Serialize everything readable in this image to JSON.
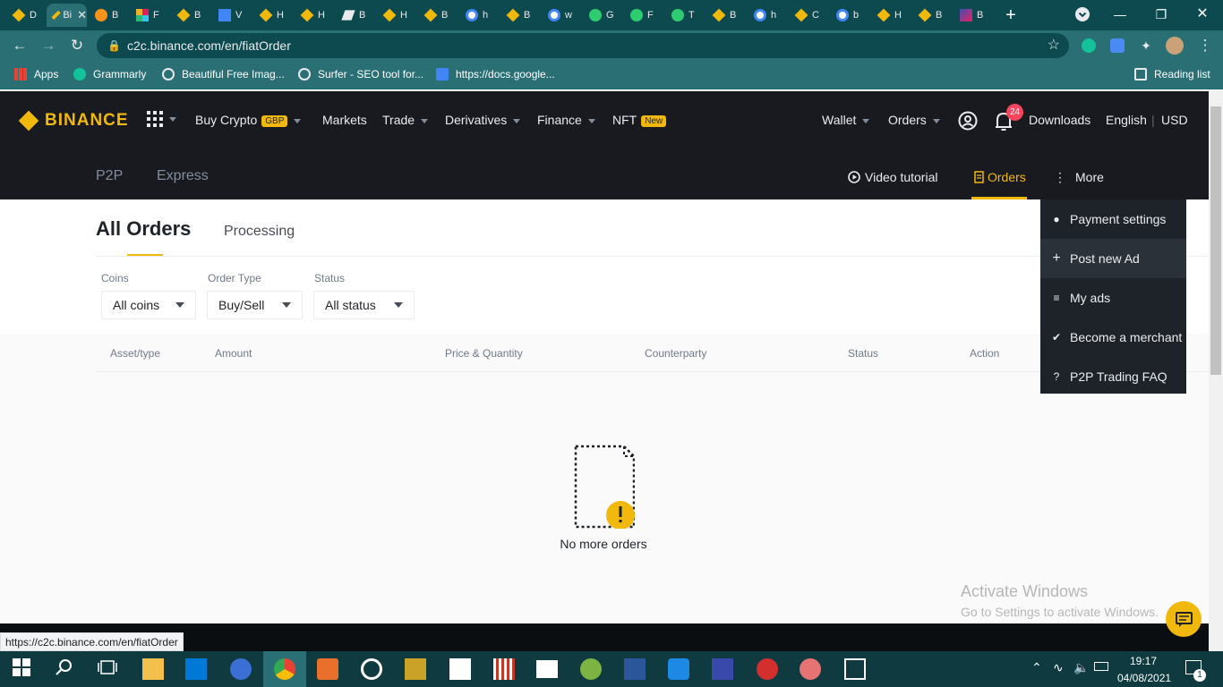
{
  "browser": {
    "tabs": [
      {
        "label": "D",
        "icon": "binance-icon"
      },
      {
        "label": "Bi",
        "icon": "binance-icon",
        "active": true
      },
      {
        "label": "B",
        "icon": "bitcoin-icon"
      },
      {
        "label": "F",
        "icon": "slack-icon"
      },
      {
        "label": "B",
        "icon": "binance-icon"
      },
      {
        "label": "V",
        "icon": "docs-icon"
      },
      {
        "label": "H",
        "icon": "binance-icon"
      },
      {
        "label": "H",
        "icon": "binance-icon"
      },
      {
        "label": "B",
        "icon": "bitmex-icon"
      },
      {
        "label": "H",
        "icon": "binance-icon"
      },
      {
        "label": "B",
        "icon": "binance-icon"
      },
      {
        "label": "h",
        "icon": "google-icon"
      },
      {
        "label": "B",
        "icon": "binance-icon"
      },
      {
        "label": "w",
        "icon": "google-icon"
      },
      {
        "label": "G",
        "icon": "surfer-icon"
      },
      {
        "label": "F",
        "icon": "surfer-icon"
      },
      {
        "label": "T",
        "icon": "surfer-icon"
      },
      {
        "label": "B",
        "icon": "binance-icon"
      },
      {
        "label": "h",
        "icon": "google-icon"
      },
      {
        "label": "C",
        "icon": "binance-icon"
      },
      {
        "label": "b",
        "icon": "google-icon"
      },
      {
        "label": "H",
        "icon": "binance-icon"
      },
      {
        "label": "B",
        "icon": "binance-icon"
      },
      {
        "label": "B",
        "icon": "image-icon"
      }
    ],
    "url": "c2c.binance.com/en/fiatOrder",
    "status_url": "https://c2c.binance.com/en/fiatOrder",
    "bookmarks": {
      "apps": "Apps",
      "grammarly": "Grammarly",
      "images": "Beautiful Free Imag...",
      "surfer": "Surfer - SEO tool for...",
      "docs": "https://docs.google...",
      "reading_list": "Reading list"
    }
  },
  "header": {
    "logo": "BINANCE",
    "buy_crypto": "Buy Crypto",
    "buy_crypto_badge": "GBP",
    "markets": "Markets",
    "trade": "Trade",
    "derivatives": "Derivatives",
    "finance": "Finance",
    "nft": "NFT",
    "nft_badge": "New",
    "wallet": "Wallet",
    "orders": "Orders",
    "notif_count": "24",
    "downloads": "Downloads",
    "language": "English",
    "currency": "USD"
  },
  "subheader": {
    "p2p": "P2P",
    "express": "Express",
    "video_tutorial": "Video tutorial",
    "orders": "Orders",
    "more": "More"
  },
  "page": {
    "title": "All Orders",
    "processing": "Processing",
    "filters": {
      "coins_label": "Coins",
      "coins_value": "All coins",
      "type_label": "Order Type",
      "type_value": "Buy/Sell",
      "status_label": "Status",
      "status_value": "All status"
    },
    "columns": [
      "Asset/type",
      "Amount",
      "Price & Quantity",
      "Counterparty",
      "Status",
      "Action"
    ],
    "empty": "No more orders"
  },
  "more_menu": [
    {
      "label": "Payment settings",
      "icon": "payment-icon"
    },
    {
      "label": "Post new Ad",
      "icon": "plus-icon"
    },
    {
      "label": "My ads",
      "icon": "sliders-icon"
    },
    {
      "label": "Become a merchant",
      "icon": "verified-icon"
    },
    {
      "label": "P2P Trading FAQ",
      "icon": "faq-icon"
    }
  ],
  "watermark": {
    "line1": "Activate Windows",
    "line2": "Go to Settings to activate Windows."
  },
  "taskbar": {
    "time": "19:17",
    "date": "04/08/2021",
    "notif_count": "1"
  },
  "colors": {
    "brand": "#f0b90b",
    "header_bg": "#181a20",
    "browser_frame": "#0d4a50"
  }
}
